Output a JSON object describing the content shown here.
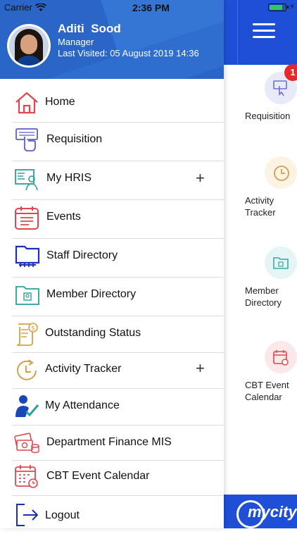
{
  "status_bar": {
    "carrier": "Carrier",
    "time": "2:36 PM"
  },
  "profile": {
    "name": "Aditi  Sood",
    "role": "Manager",
    "last_visited": "Last Visited: 05 August 2019 14:36"
  },
  "menu": [
    {
      "label": "Home",
      "icon": "home-icon",
      "expandable": false
    },
    {
      "label": "Requisition",
      "icon": "requisition-icon",
      "expandable": false
    },
    {
      "label": "My HRIS",
      "icon": "hris-icon",
      "expandable": true
    },
    {
      "label": "Events",
      "icon": "events-icon",
      "expandable": false
    },
    {
      "label": "Staff Directory",
      "icon": "staff-directory-icon",
      "expandable": false
    },
    {
      "label": "Member Directory",
      "icon": "member-directory-icon",
      "expandable": false
    },
    {
      "label": "Outstanding Status",
      "icon": "outstanding-status-icon",
      "expandable": false
    },
    {
      "label": "Activity Tracker",
      "icon": "activity-tracker-icon",
      "expandable": true
    },
    {
      "label": "My Attendance",
      "icon": "attendance-icon",
      "expandable": false
    },
    {
      "label": "Department Finance MIS",
      "icon": "finance-mis-icon",
      "expandable": false
    },
    {
      "label": "CBT Event Calendar",
      "icon": "event-calendar-icon",
      "expandable": false
    },
    {
      "label": "Logout",
      "icon": "logout-icon",
      "expandable": false
    }
  ],
  "plus_symbol": "+",
  "background_app": {
    "requisition_badge": "1",
    "tiles": [
      {
        "label": "Requisition",
        "icon": "requisition-icon"
      },
      {
        "label": "Activity\nTracker",
        "icon": "activity-tracker-icon"
      },
      {
        "label": "Member\nDirectory",
        "icon": "member-directory-icon"
      },
      {
        "label": "CBT Event\nCalendar",
        "icon": "event-calendar-icon"
      }
    ],
    "footer_logo": "mycity"
  },
  "colors": {
    "header_blue": "#1e4fd6",
    "profile_blue": "#2a66c8",
    "badge_red": "#e32b2b"
  }
}
